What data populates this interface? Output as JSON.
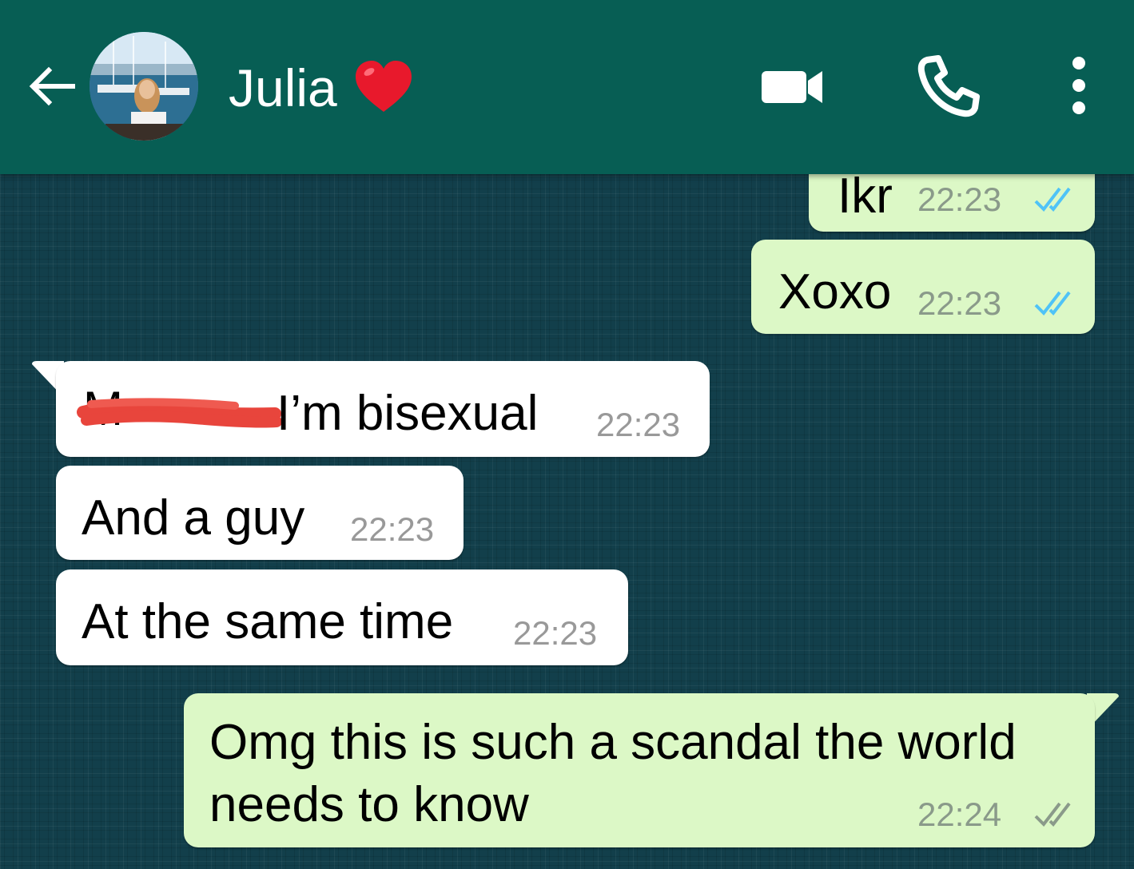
{
  "header": {
    "contact_name": "Julia",
    "back_icon": "arrow-left-icon",
    "heart_icon": "red-heart-emoji",
    "video_icon": "video-camera-icon",
    "call_icon": "phone-icon",
    "menu_icon": "more-vertical-icon",
    "color": "#075e54"
  },
  "messages": [
    {
      "direction": "out",
      "text": "Ikr",
      "time": "22:23",
      "status": "read"
    },
    {
      "direction": "out",
      "text": "Xoxo",
      "time": "22:23",
      "status": "read"
    },
    {
      "direction": "in",
      "text": "I’m bisexual",
      "time": "22:23",
      "redacted_prefix": true
    },
    {
      "direction": "in",
      "text": "And a guy",
      "time": "22:23"
    },
    {
      "direction": "in",
      "text": "At the same time",
      "time": "22:23"
    },
    {
      "direction": "out",
      "text_line1": "Omg this is such a scandal the world",
      "text_line2": "needs to know",
      "time": "22:24",
      "status": "delivered"
    }
  ],
  "colors": {
    "outgoing_bubble": "#dcf8c6",
    "incoming_bubble": "#ffffff",
    "read_ticks": "#4fc3f7",
    "delivered_ticks": "#8a9a8a",
    "chat_background": "#123f4b"
  }
}
